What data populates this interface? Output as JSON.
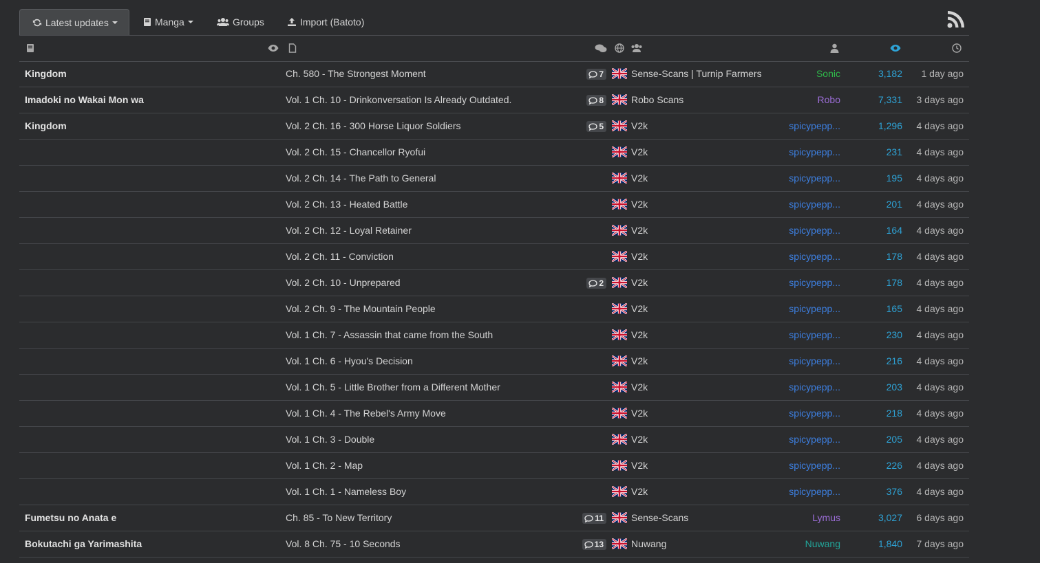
{
  "nav": {
    "tabs": [
      {
        "label": "Latest updates",
        "icon": "refresh-icon",
        "active": true
      },
      {
        "label": "Manga",
        "icon": "book-icon"
      },
      {
        "label": "Groups",
        "icon": "users-icon"
      },
      {
        "label": "Import (Batoto)",
        "icon": "upload-icon"
      }
    ],
    "rss_icon": "rss-icon"
  },
  "header_icons": [
    "manga-title-icon",
    "views-icon",
    "chapter-icon",
    "comments-icon",
    "language-icon",
    "group-icon",
    "uploader-icon",
    "chapter-views-icon",
    "time-icon"
  ],
  "colors": {
    "accent": "#2ea3d6",
    "sonic": "#2fb84a",
    "robo": "#9b6dd6",
    "spicy": "#3d7fe0",
    "lymus": "#9b6dd6",
    "nuwang": "#22a69a"
  },
  "rows": [
    {
      "manga": "Kingdom",
      "chapter": "Ch. 580 - The Strongest Moment",
      "comments": "7",
      "group": "Sense-Scans | Turnip Farmers",
      "uploader": "Sonic",
      "uploader_color": "#2fb84a",
      "views": "3,182",
      "time": "1 day ago"
    },
    {
      "manga": "Imadoki no Wakai Mon wa",
      "chapter": "Vol. 1 Ch. 10 - Drinkonversation Is Already Outdated.",
      "comments": "8",
      "group": "Robo Scans",
      "uploader": "Robo",
      "uploader_color": "#9b6dd6",
      "views": "7,331",
      "time": "3 days ago"
    },
    {
      "manga": "Kingdom",
      "chapter": "Vol. 2 Ch. 16 - 300 Horse Liquor Soldiers",
      "comments": "5",
      "group": "V2k",
      "uploader": "spicypepp...",
      "uploader_color": "#3d7fe0",
      "views": "1,296",
      "time": "4 days ago"
    },
    {
      "manga": "",
      "chapter": "Vol. 2 Ch. 15 - Chancellor Ryofui",
      "comments": "",
      "group": "V2k",
      "uploader": "spicypepp...",
      "uploader_color": "#3d7fe0",
      "views": "231",
      "time": "4 days ago"
    },
    {
      "manga": "",
      "chapter": "Vol. 2 Ch. 14 - The Path to General",
      "comments": "",
      "group": "V2k",
      "uploader": "spicypepp...",
      "uploader_color": "#3d7fe0",
      "views": "195",
      "time": "4 days ago"
    },
    {
      "manga": "",
      "chapter": "Vol. 2 Ch. 13 - Heated Battle",
      "comments": "",
      "group": "V2k",
      "uploader": "spicypepp...",
      "uploader_color": "#3d7fe0",
      "views": "201",
      "time": "4 days ago"
    },
    {
      "manga": "",
      "chapter": "Vol. 2 Ch. 12 - Loyal Retainer",
      "comments": "",
      "group": "V2k",
      "uploader": "spicypepp...",
      "uploader_color": "#3d7fe0",
      "views": "164",
      "time": "4 days ago"
    },
    {
      "manga": "",
      "chapter": "Vol. 2 Ch. 11 - Conviction",
      "comments": "",
      "group": "V2k",
      "uploader": "spicypepp...",
      "uploader_color": "#3d7fe0",
      "views": "178",
      "time": "4 days ago"
    },
    {
      "manga": "",
      "chapter": "Vol. 2 Ch. 10 - Unprepared",
      "comments": "2",
      "group": "V2k",
      "uploader": "spicypepp...",
      "uploader_color": "#3d7fe0",
      "views": "178",
      "time": "4 days ago"
    },
    {
      "manga": "",
      "chapter": "Vol. 2 Ch. 9 - The Mountain People",
      "comments": "",
      "group": "V2k",
      "uploader": "spicypepp...",
      "uploader_color": "#3d7fe0",
      "views": "165",
      "time": "4 days ago"
    },
    {
      "manga": "",
      "chapter": "Vol. 1 Ch. 7 - Assassin that came from the South",
      "comments": "",
      "group": "V2k",
      "uploader": "spicypepp...",
      "uploader_color": "#3d7fe0",
      "views": "230",
      "time": "4 days ago"
    },
    {
      "manga": "",
      "chapter": "Vol. 1 Ch. 6 - Hyou's Decision",
      "comments": "",
      "group": "V2k",
      "uploader": "spicypepp...",
      "uploader_color": "#3d7fe0",
      "views": "216",
      "time": "4 days ago"
    },
    {
      "manga": "",
      "chapter": "Vol. 1 Ch. 5 - Little Brother from a Different Mother",
      "comments": "",
      "group": "V2k",
      "uploader": "spicypepp...",
      "uploader_color": "#3d7fe0",
      "views": "203",
      "time": "4 days ago"
    },
    {
      "manga": "",
      "chapter": "Vol. 1 Ch. 4 - The Rebel's Army Move",
      "comments": "",
      "group": "V2k",
      "uploader": "spicypepp...",
      "uploader_color": "#3d7fe0",
      "views": "218",
      "time": "4 days ago"
    },
    {
      "manga": "",
      "chapter": "Vol. 1 Ch. 3 - Double",
      "comments": "",
      "group": "V2k",
      "uploader": "spicypepp...",
      "uploader_color": "#3d7fe0",
      "views": "205",
      "time": "4 days ago"
    },
    {
      "manga": "",
      "chapter": "Vol. 1 Ch. 2 - Map",
      "comments": "",
      "group": "V2k",
      "uploader": "spicypepp...",
      "uploader_color": "#3d7fe0",
      "views": "226",
      "time": "4 days ago"
    },
    {
      "manga": "",
      "chapter": "Vol. 1 Ch. 1 - Nameless Boy",
      "comments": "",
      "group": "V2k",
      "uploader": "spicypepp...",
      "uploader_color": "#3d7fe0",
      "views": "376",
      "time": "4 days ago"
    },
    {
      "manga": "Fumetsu no Anata e",
      "chapter": "Ch. 85 - To New Territory",
      "comments": "11",
      "group": "Sense-Scans",
      "uploader": "Lymus",
      "uploader_color": "#9b6dd6",
      "views": "3,027",
      "time": "6 days ago"
    },
    {
      "manga": "Bokutachi ga Yarimashita",
      "chapter": "Vol. 8 Ch. 75 - 10 Seconds",
      "comments": "13",
      "group": "Nuwang",
      "uploader": "Nuwang",
      "uploader_color": "#22a69a",
      "views": "1,840",
      "time": "7 days ago"
    }
  ]
}
